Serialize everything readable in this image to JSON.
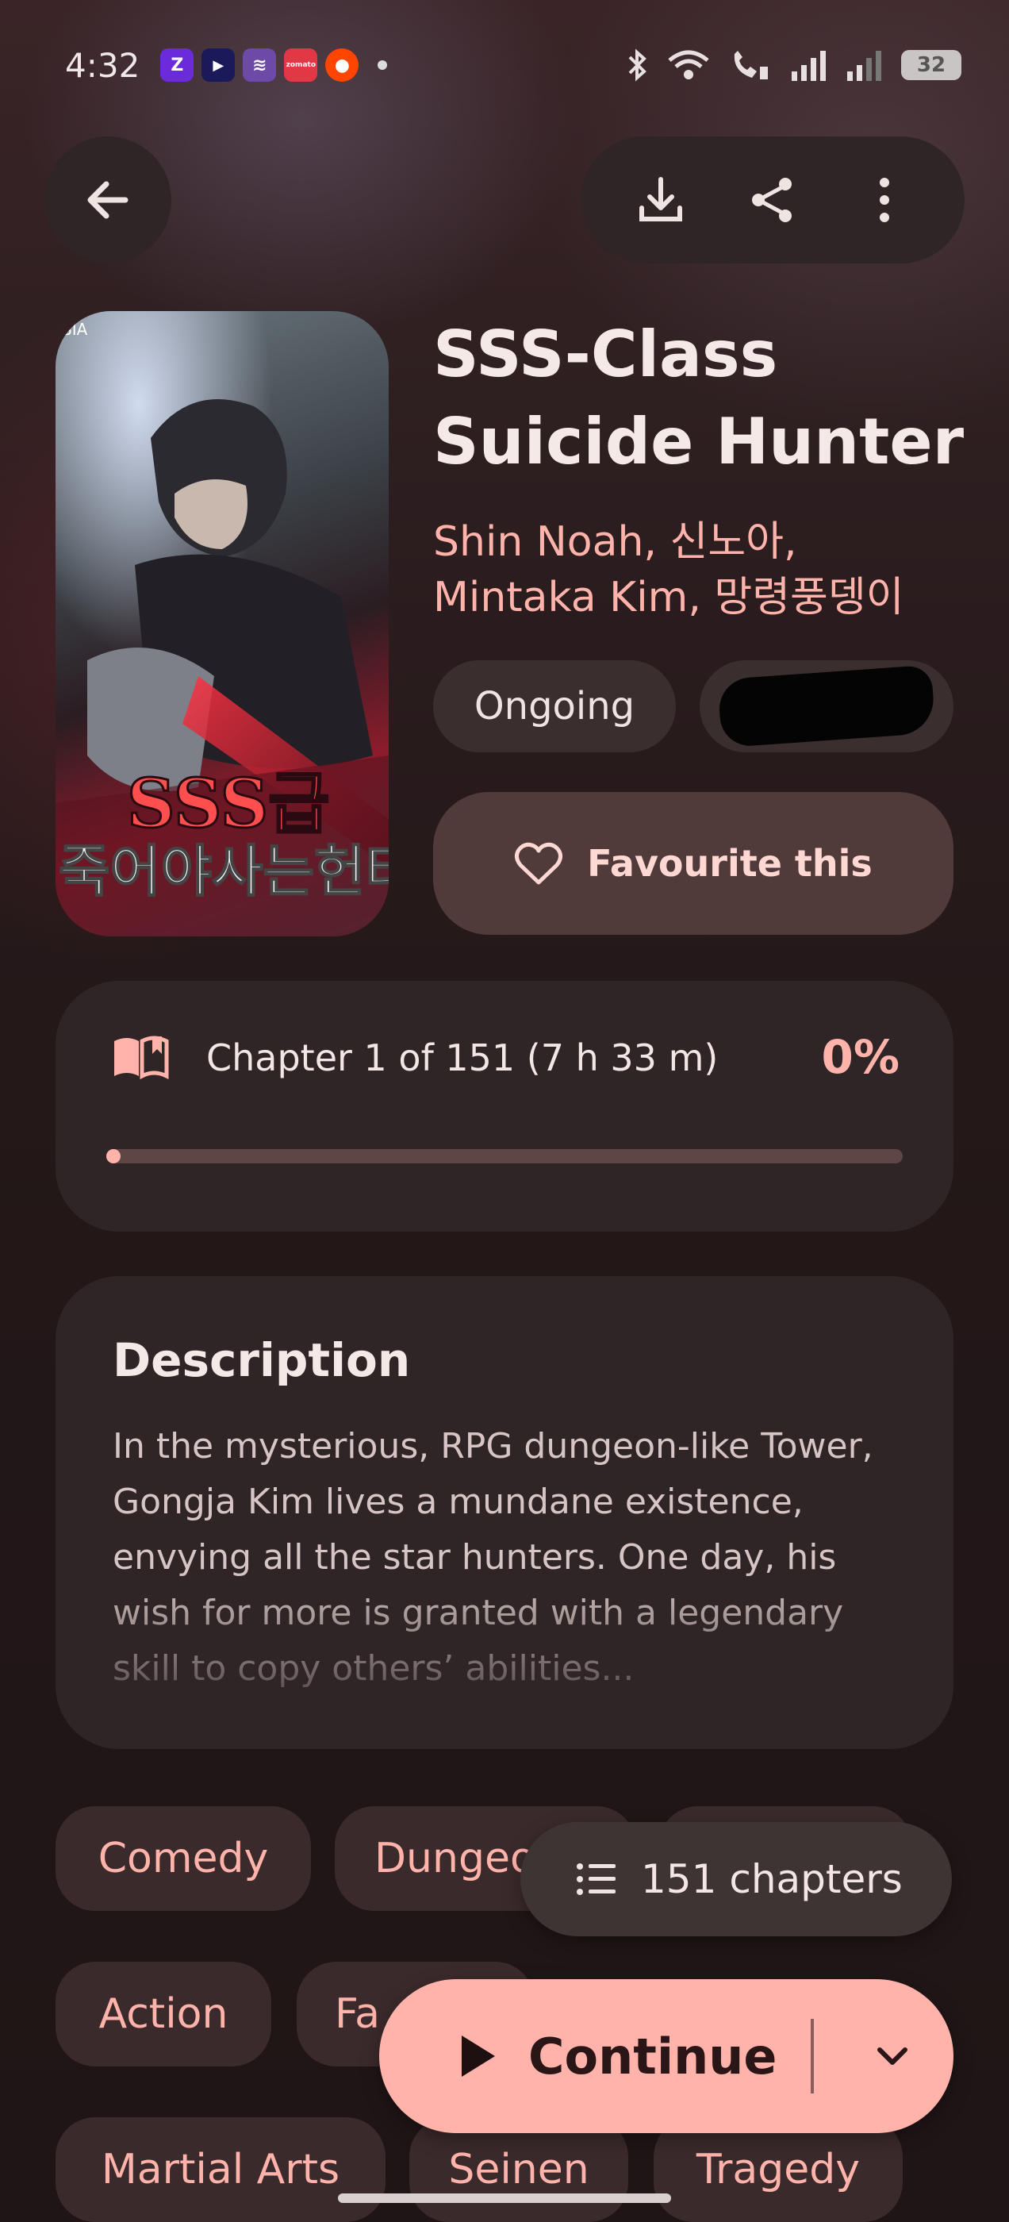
{
  "status_bar": {
    "time": "4:32",
    "apps": [
      {
        "name": "zepto",
        "glyph": "Z",
        "color": "#6b2bd9"
      },
      {
        "name": "youtube-tv",
        "glyph": "▶",
        "color": "#1a1a5a"
      },
      {
        "name": "app3",
        "glyph": "≋",
        "color": "#6d4aa8"
      },
      {
        "name": "zomato",
        "glyph": "zomato",
        "color": "#e23744"
      },
      {
        "name": "reddit",
        "glyph": "●",
        "color": "#ff4500"
      }
    ],
    "battery": "32"
  },
  "book": {
    "title_line1": "SSS-Class",
    "title_line2": "Suicide Hunter",
    "authors_line1": "Shin Noah, 신노아,",
    "authors_line2": "Mintaka Kim, 망령풍뎅이",
    "status": "Ongoing",
    "favourite_label": "Favourite this"
  },
  "progress": {
    "label": "Chapter 1 of 151 (7 h 33 m)",
    "percent_text": "0%",
    "fraction": 0.01
  },
  "description": {
    "title": "Description",
    "text": "In the mysterious, RPG dungeon-like Tower, Gongja Kim lives a mundane existence, envying all the star hunters. One day, his wish for more is granted with a legendary skill to copy others’ abilities..."
  },
  "genres": {
    "row1": [
      "Comedy",
      "Dungeo"
    ],
    "row2": [
      "Action",
      "Fa"
    ],
    "row3": [
      "Martial Arts",
      "Seinen",
      "Tragedy"
    ]
  },
  "fab": {
    "chapters_label": "151 chapters",
    "continue_label": "Continue"
  },
  "colors": {
    "accent": "#ffb3ab",
    "surface": "#2f2526",
    "background": "#241819"
  }
}
